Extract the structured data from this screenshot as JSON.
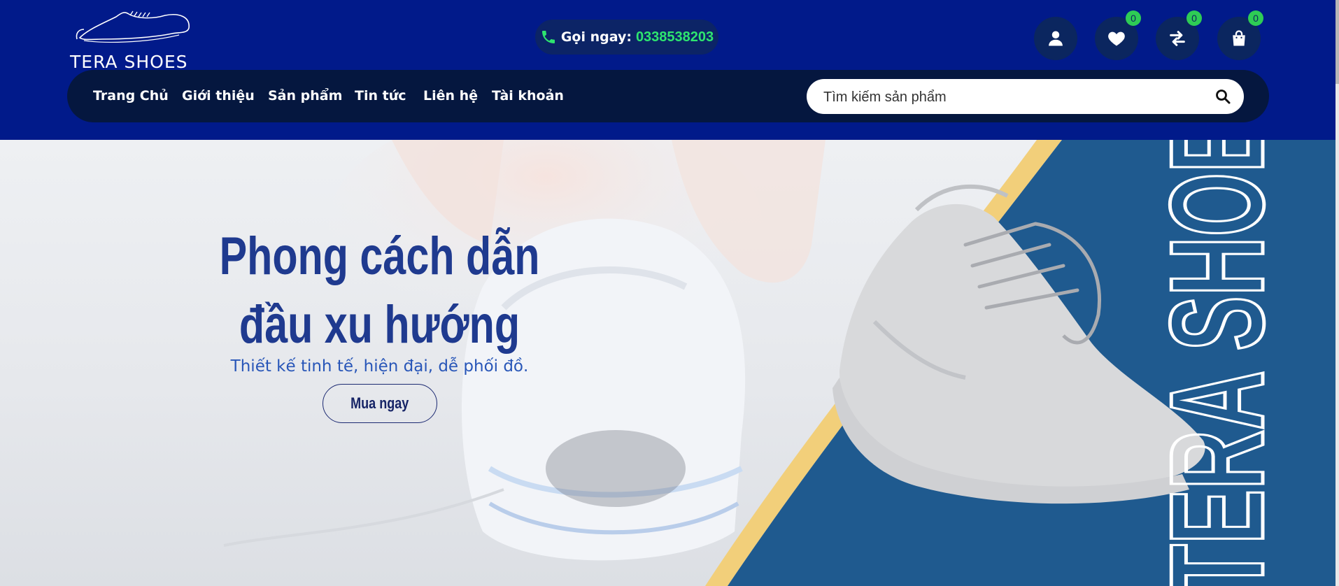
{
  "header": {
    "logo_text": "TERA SHOES",
    "hotline_label": "Gọi ngay:",
    "hotline_number": "0338538203",
    "icons": [
      {
        "name": "account",
        "badge": null
      },
      {
        "name": "wishlist",
        "badge": "0"
      },
      {
        "name": "compare",
        "badge": "0"
      },
      {
        "name": "cart",
        "badge": "0"
      }
    ]
  },
  "nav": {
    "items": [
      "Trang Chủ",
      "Giới thiệu",
      "Sản phẩm",
      "Tin tức",
      "Liên hệ",
      "Tài khoản"
    ]
  },
  "search": {
    "placeholder": "Tìm kiếm sản phẩm"
  },
  "hero": {
    "title": "Phong cách dẫn đầu xu hướng",
    "subtitle": "Thiết kế tinh tế, hiện đại, dễ phối đồ.",
    "cta": "Mua ngay",
    "vertical_text": "TERA SHOES"
  },
  "colors": {
    "header_bg": "#011a8a",
    "nav_bg": "#05173f",
    "accent_green": "#2ee56f",
    "hero_blue": "#1f5a8f",
    "hero_yellow": "#f2cf7a",
    "title_color": "#1f3a8f"
  }
}
